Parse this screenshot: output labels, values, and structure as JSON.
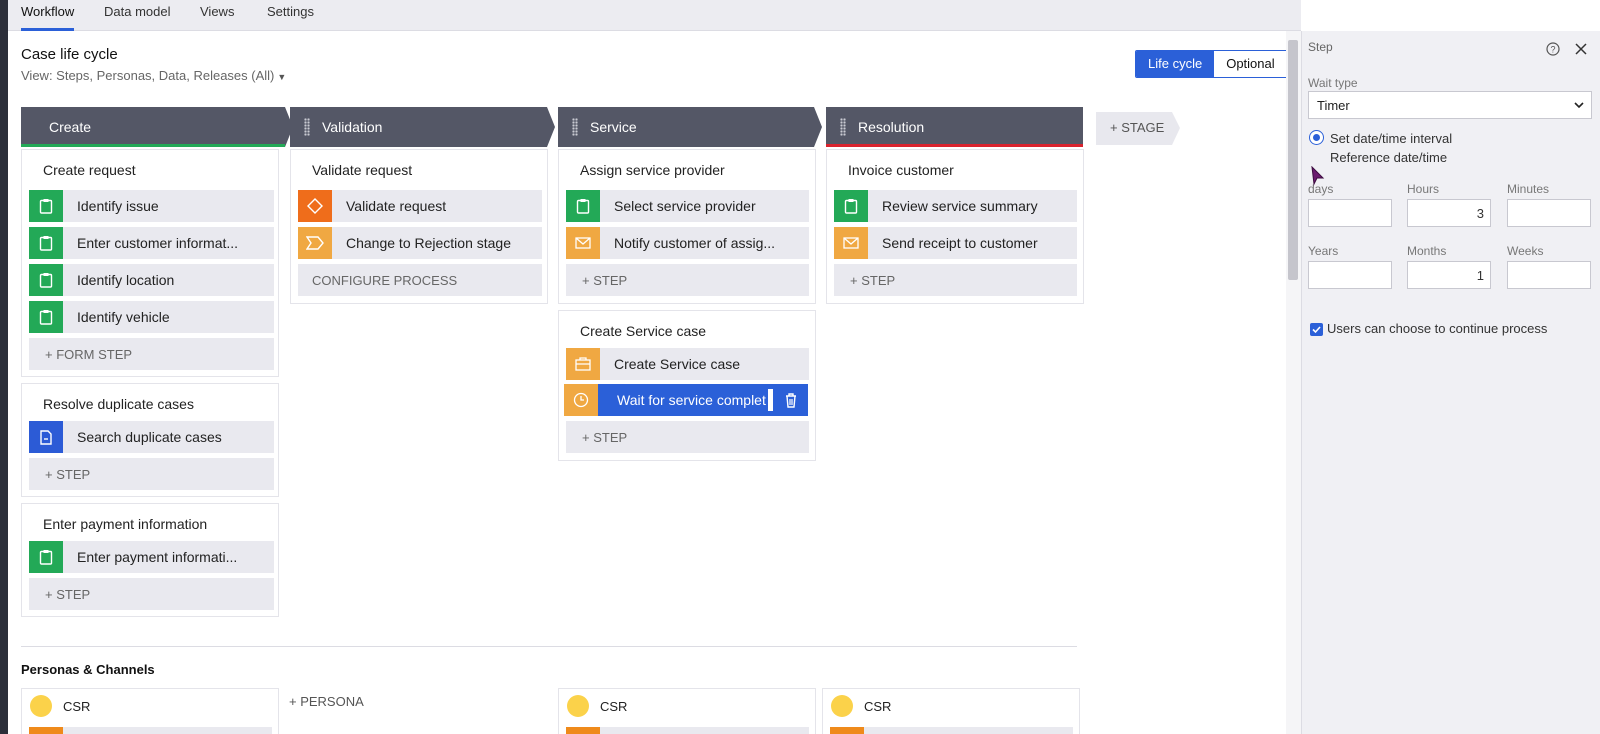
{
  "tabs": [
    "Workflow",
    "Data model",
    "Views",
    "Settings"
  ],
  "header": {
    "title": "Case life cycle",
    "view": "View: Steps, Personas, Data, Releases (All)",
    "toggle_on": "Life cycle",
    "toggle_off": "Optional"
  },
  "stages": [
    {
      "name": "Create",
      "bar_color": "#23a957"
    },
    {
      "name": "Validation",
      "bar_color": ""
    },
    {
      "name": "Service",
      "bar_color": ""
    },
    {
      "name": "Resolution",
      "bar_color": "#d9232e"
    }
  ],
  "add_stage": "+ STAGE",
  "processes": {
    "create_request": {
      "title": "Create request",
      "steps": [
        "Identify issue",
        "Enter customer informat...",
        "Identify location",
        "Identify vehicle"
      ],
      "add": "+ FORM STEP"
    },
    "resolve_duplicates": {
      "title": "Resolve duplicate cases",
      "steps": [
        "Search duplicate cases"
      ],
      "add": "+ STEP"
    },
    "enter_payment": {
      "title": "Enter payment information",
      "steps": [
        "Enter payment informati..."
      ],
      "add": "+ STEP"
    },
    "validate_request": {
      "title": "Validate request",
      "steps": [
        "Validate request",
        "Change to Rejection stage"
      ],
      "add": "CONFIGURE PROCESS"
    },
    "assign_provider": {
      "title": "Assign service provider",
      "steps": [
        "Select service provider",
        "Notify customer of assig..."
      ],
      "add": "+ STEP"
    },
    "create_service_case": {
      "title": "Create Service case",
      "steps": [
        "Create Service case"
      ],
      "editing_value": "Wait for service complet",
      "add": "+ STEP"
    },
    "invoice_customer": {
      "title": "Invoice customer",
      "steps": [
        "Review service summary",
        "Send receipt to customer"
      ],
      "add": "+ STEP"
    }
  },
  "personas": {
    "title": "Personas & Channels",
    "name": "CSR",
    "add": "+ PERSONA"
  },
  "panel": {
    "title": "Step",
    "wait_type_label": "Wait type",
    "wait_type_value": "Timer",
    "radio_interval": "Set date/time interval",
    "radio_reference": "Reference date/time",
    "labels": {
      "days": "days",
      "hours": "Hours",
      "minutes": "Minutes",
      "years": "Years",
      "months": "Months",
      "weeks": "Weeks"
    },
    "values": {
      "days": "",
      "hours": "3",
      "minutes": "",
      "years": "",
      "months": "1",
      "weeks": ""
    },
    "checkbox_label": "Users can choose to continue process"
  },
  "colors": {
    "accent": "#2b60d8",
    "stage_bg": "#545766",
    "form_step": "#23a957",
    "notify_step": "#f0a842"
  }
}
